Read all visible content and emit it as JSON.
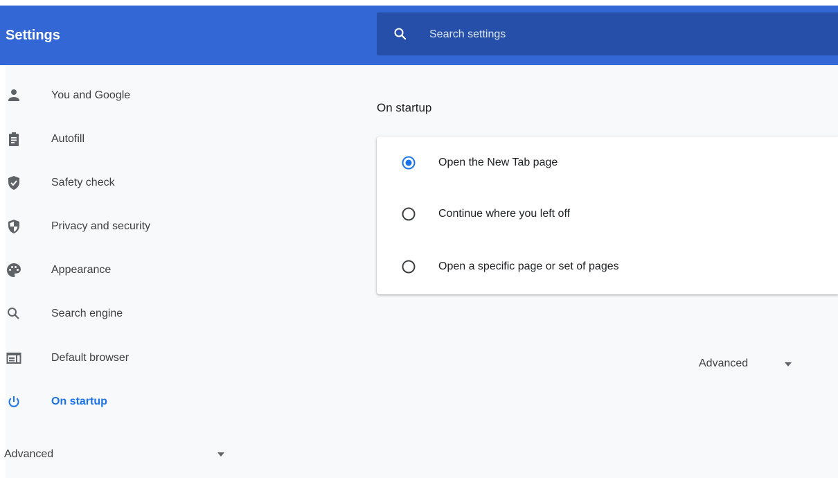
{
  "header": {
    "title": "Settings",
    "search": {
      "placeholder": "Search settings",
      "value": "",
      "icon": "search-icon"
    },
    "color": "#3367d6"
  },
  "sidebar": {
    "items": [
      {
        "label": "You and Google",
        "icon": "person-icon",
        "active": false
      },
      {
        "label": "Autofill",
        "icon": "clipboard-icon",
        "active": false
      },
      {
        "label": "Safety check",
        "icon": "shield-check-icon",
        "active": false
      },
      {
        "label": "Privacy and security",
        "icon": "shield-half-icon",
        "active": false
      },
      {
        "label": "Appearance",
        "icon": "palette-icon",
        "active": false
      },
      {
        "label": "Search engine",
        "icon": "search-icon",
        "active": false
      },
      {
        "label": "Default browser",
        "icon": "browser-icon",
        "active": false
      },
      {
        "label": "On startup",
        "icon": "power-icon",
        "active": true
      }
    ],
    "advanced_label": "Advanced"
  },
  "main": {
    "section_title": "On startup",
    "options": [
      {
        "label": "Open the New Tab page",
        "selected": true
      },
      {
        "label": "Continue where you left off",
        "selected": false
      },
      {
        "label": "Open a specific page or set of pages",
        "selected": false
      }
    ],
    "advanced_label": "Advanced"
  },
  "colors": {
    "accent": "#1a73e8",
    "header": "#3367d6",
    "search_bg": "#254fa8",
    "icon": "#5f6368"
  }
}
